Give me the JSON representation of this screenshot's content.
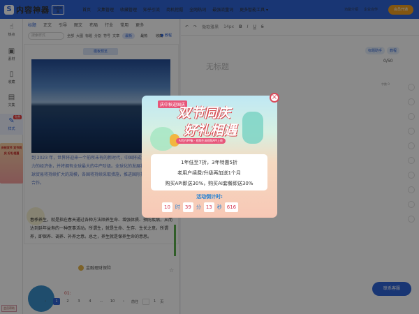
{
  "topbar": {
    "logo_text": "内容神器",
    "logo_tag": "内容神器",
    "nav": [
      "首页",
      "文集管理",
      "收藏管理",
      "知乎引流",
      "商机挖掘",
      "全网热词",
      "最强流量词",
      "更多智能工具 ▾"
    ],
    "links": [
      "功能介绍",
      "企业合作"
    ],
    "vip": "会员开通"
  },
  "leftbar": {
    "items": [
      "热点",
      "素材",
      "收藏",
      "文集",
      "样式"
    ],
    "new_badge": "免费",
    "ad_text": "庆祝双节 双节同庆 好礼相遇",
    "help": "会员帮助"
  },
  "panel": {
    "categories": [
      "标题",
      "正文",
      "引导",
      "图文",
      "布局",
      "行业",
      "常用",
      "更多"
    ],
    "search_placeholder": "搜索样式",
    "filters": [
      "全部",
      "大图",
      "标题",
      "分割",
      "符号",
      "文章"
    ],
    "pill_new": "最新",
    "pill_hot": "最热",
    "pill_fav": "收藏",
    "tutorial": "教程",
    "template_header": "模板预览",
    "para1": "到 2023 年，世界将迎来一个前所未有的新时代，中国将成为全球最具影响力的经济体，并将拥有全球最大的中产阶级。全球化的发展将更加深入，全球贸易将持续扩大的规模，各国将持续采取措施，推进国际投资，加强国际合作。",
    "para2": "春季养生，就是指在春天通过各种方法顺养生命、增强体质、预防疾病，从而达到延年益寿的一种医事活动。所谓生，就是生命、生存、生长之意。所谓养，即保养、调养、补养之意。总之，养生就是保养生命的意思。",
    "card2_title": "金融理财保险",
    "card2_text": "01:",
    "pager": [
      "1",
      "2",
      "3",
      "4",
      "...",
      "10"
    ],
    "page_label": "前往",
    "page_unit": "页",
    "page_value": "1"
  },
  "editor": {
    "toolbar": [
      "↶",
      "↷",
      "微软雅黑",
      "14px",
      "B",
      "I",
      "U",
      "S"
    ],
    "assistant": [
      "标题助手",
      "教程"
    ],
    "title_placeholder": "无标题",
    "title_count": "0/50",
    "word_count": "字数 0",
    "support": "联系客服"
  },
  "popup": {
    "sub": "庆中秋迎国庆",
    "title_1": "双节同庆",
    "title_2": "好礼相遇",
    "tag": "AI写作PP集 · 视频生成视频API上线",
    "line1": "1年低至7折，3年特惠5折",
    "line2": "老用户续费/升级再加送1个月",
    "line3": "购买API即送30%，购买AI套餐即送30%",
    "countdown_label": "活动倒计时:",
    "countdown": [
      {
        "value": "10",
        "unit": "时"
      },
      {
        "value": "39",
        "unit": "分"
      },
      {
        "value": "13",
        "unit": "秒"
      },
      {
        "value": "616",
        "unit": ""
      }
    ],
    "close": "×"
  }
}
